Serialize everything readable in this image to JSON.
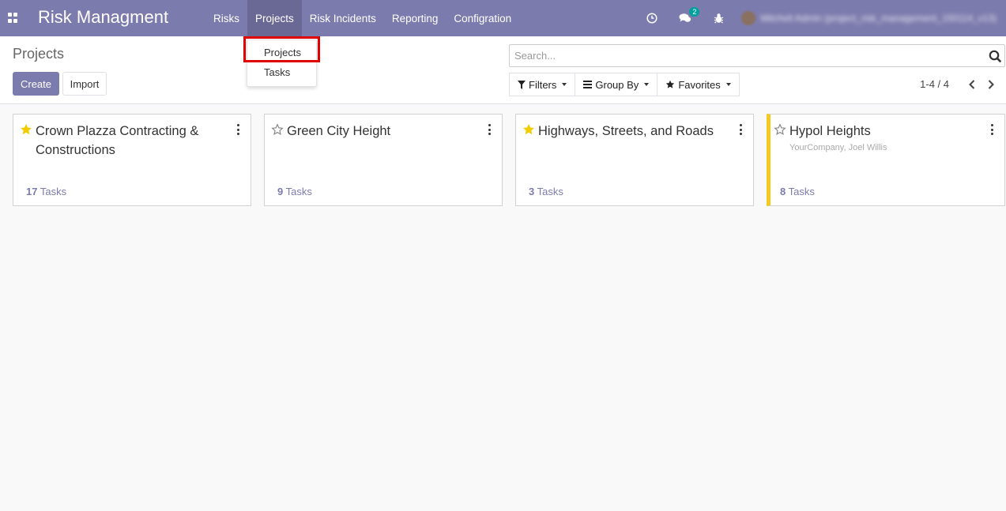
{
  "app": {
    "brand": "Risk Managment",
    "menu": [
      {
        "label": "Risks"
      },
      {
        "label": "Projects"
      },
      {
        "label": "Risk Incidents"
      },
      {
        "label": "Reporting"
      },
      {
        "label": "Configration"
      }
    ],
    "messages_badge": "2",
    "user_name": "Mitchell Admin (project_risk_management_150114_v13)"
  },
  "dropdown": {
    "items": [
      {
        "label": "Projects"
      },
      {
        "label": "Tasks"
      }
    ]
  },
  "control_panel": {
    "breadcrumb": "Projects",
    "create_label": "Create",
    "import_label": "Import",
    "search_placeholder": "Search...",
    "filters_label": "Filters",
    "group_by_label": "Group By",
    "favorites_label": "Favorites",
    "pager": "1-4 / 4"
  },
  "projects": [
    {
      "title": "Crown Plazza Contracting & Constructions",
      "favorite": true,
      "subtitle": "",
      "task_count": "17",
      "tasks_label": "Tasks"
    },
    {
      "title": "Green City Height",
      "favorite": false,
      "subtitle": "",
      "task_count": "9",
      "tasks_label": "Tasks"
    },
    {
      "title": "Highways, Streets, and Roads",
      "favorite": true,
      "subtitle": "",
      "task_count": "3",
      "tasks_label": "Tasks"
    },
    {
      "title": "Hypol Heights",
      "favorite": false,
      "subtitle": "YourCompany, Joel Willis",
      "task_count": "8",
      "tasks_label": "Tasks",
      "color": "#f4ca20"
    }
  ],
  "colors": {
    "primary": "#7c7bad",
    "favorite_star": "#f3cc00",
    "highlight": "#e00000",
    "card_accent_yellow": "#f4ca20",
    "badge": "#00a09d"
  }
}
